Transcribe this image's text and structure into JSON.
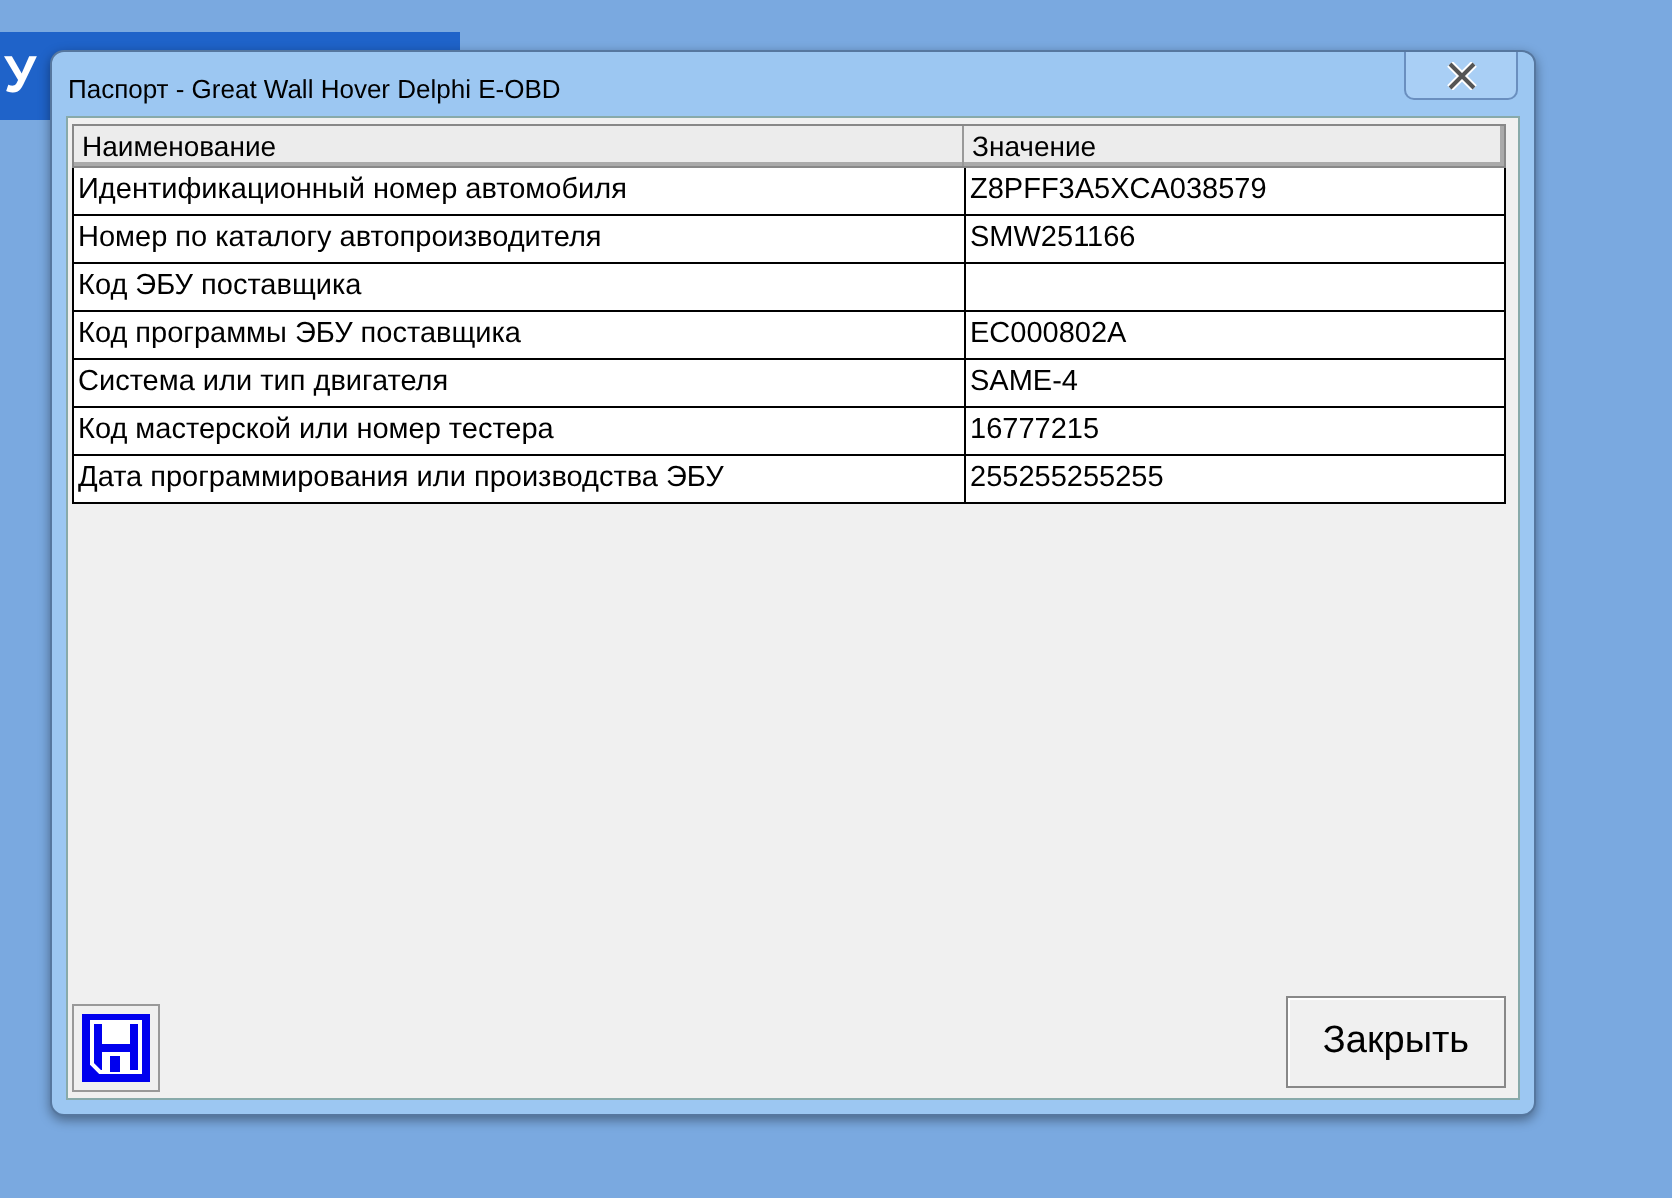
{
  "background_window": {
    "title": "У"
  },
  "window": {
    "title": "Паспорт - Great Wall Hover Delphi E-OBD"
  },
  "table": {
    "columns": [
      "Наименование",
      "Значение"
    ],
    "rows": [
      {
        "name": "Идентификационный номер автомобиля",
        "value": "Z8PFF3A5XCA038579"
      },
      {
        "name": "Номер по каталогу автопроизводителя",
        "value": "SMW251166"
      },
      {
        "name": "Код ЭБУ поставщика"
      },
      {
        "name": "Код программы ЭБУ поставщика",
        "value": "EC000802A"
      },
      {
        "name": "Система или тип двигателя",
        "value": "SAME-4"
      },
      {
        "name": "Код мастерской или номер тестера",
        "value": "16777215"
      },
      {
        "name": "Дата программирования или производства ЭБУ",
        "value": "255255255255"
      }
    ]
  },
  "buttons": [
    "Закрыть"
  ]
}
